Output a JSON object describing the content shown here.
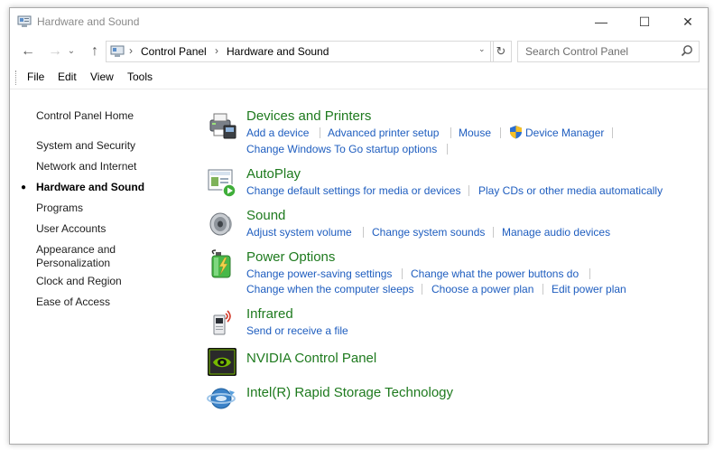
{
  "window": {
    "title": "Hardware and Sound",
    "controls": {
      "minimize": "—",
      "maximize": "☐",
      "close": "✕"
    }
  },
  "nav": {
    "back": "←",
    "forward": "→",
    "recent": "⌄",
    "up": "↑",
    "refresh": "↻"
  },
  "address": {
    "crumbs": [
      "Control Panel",
      "Hardware and Sound"
    ],
    "separator": "›",
    "dropdown": "⌄"
  },
  "search": {
    "placeholder": "Search Control Panel"
  },
  "menu": [
    "File",
    "Edit",
    "View",
    "Tools"
  ],
  "sidebar": {
    "items": [
      {
        "label": "Control Panel Home"
      },
      {
        "label": "System and Security"
      },
      {
        "label": "Network and Internet"
      },
      {
        "label": "Hardware and Sound",
        "current": true
      },
      {
        "label": "Programs"
      },
      {
        "label": "User Accounts"
      },
      {
        "label": "Appearance and Personalization"
      },
      {
        "label": "Clock and Region"
      },
      {
        "label": "Ease of Access"
      }
    ],
    "bullet": "●"
  },
  "categories": [
    {
      "title": "Devices and Printers",
      "icon": "printer-icon",
      "lines": [
        [
          "Add a device",
          "Advanced printer setup",
          "Mouse",
          "Device Manager"
        ],
        [
          "Change Windows To Go startup options"
        ]
      ]
    },
    {
      "title": "AutoPlay",
      "icon": "autoplay-icon",
      "lines": [
        [
          "Change default settings for media or devices",
          "Play CDs or other media automatically"
        ]
      ]
    },
    {
      "title": "Sound",
      "icon": "speaker-icon",
      "lines": [
        [
          "Adjust system volume",
          "Change system sounds",
          "Manage audio devices"
        ]
      ]
    },
    {
      "title": "Power Options",
      "icon": "battery-icon",
      "lines": [
        [
          "Change power-saving settings",
          "Change what the power buttons do"
        ],
        [
          "Change when the computer sleeps",
          "Choose a power plan",
          "Edit power plan"
        ]
      ]
    },
    {
      "title": "Infrared",
      "icon": "infrared-icon",
      "lines": [
        [
          "Send or receive a file"
        ]
      ]
    },
    {
      "title": "NVIDIA Control Panel",
      "icon": "nvidia-icon",
      "lines": []
    },
    {
      "title": "Intel(R) Rapid Storage Technology",
      "icon": "intel-rst-icon",
      "lines": []
    }
  ],
  "colors": {
    "category_title": "#1e7a1e",
    "link": "#1e5dbf",
    "title_text": "#8a8a8a"
  }
}
